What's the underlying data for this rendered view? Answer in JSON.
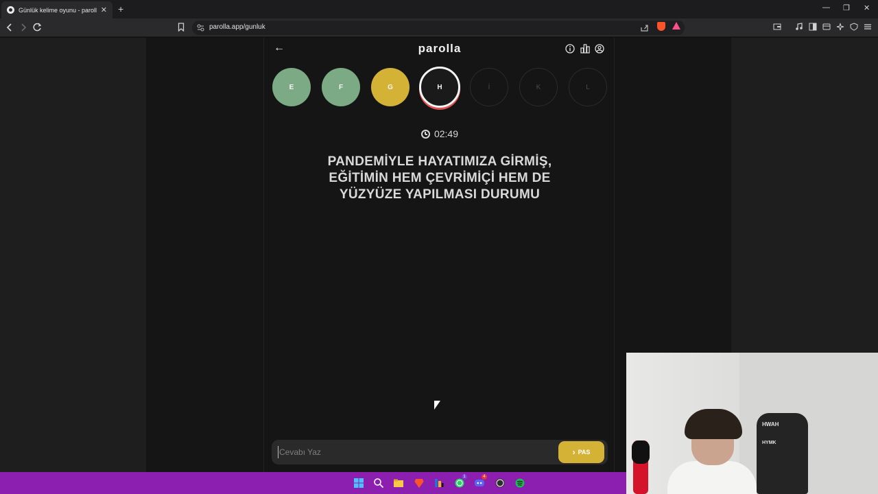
{
  "browser": {
    "tab_title": "Günlük kelime oyunu - parolla -",
    "tab_close": "✕",
    "new_tab": "+",
    "url": "parolla.app/gunluk",
    "win_min": "—",
    "win_max": "❐",
    "win_close": "✕"
  },
  "app": {
    "logo": "parolla",
    "back": "←",
    "letters": [
      {
        "letter": "E",
        "state": "correct"
      },
      {
        "letter": "F",
        "state": "correct"
      },
      {
        "letter": "G",
        "state": "passed"
      },
      {
        "letter": "H",
        "state": "active"
      },
      {
        "letter": "İ",
        "state": "pending"
      },
      {
        "letter": "K",
        "state": "pending"
      },
      {
        "letter": "L",
        "state": "pending"
      }
    ],
    "timer": "02:49",
    "question": "PANDEMİYLE HAYATIMIZA GİRMİŞ, EĞİTİMİN HEM ÇEVRİMİÇİ HEM DE YÜZYÜZE YAPILMASI DURUMU",
    "answer_placeholder": "Cevabı Yaz",
    "pass_label": "PAS",
    "pass_icon": "›"
  },
  "webcam": {
    "chair_brand": "HWAH",
    "chair_text": "HYMK"
  },
  "taskbar": {
    "badges": [
      "1",
      "4"
    ]
  },
  "colors": {
    "correct": "#7caa84",
    "passed": "#d4b236",
    "active_ring": "#f4f4f4",
    "taskbar": "#8c1fb0"
  }
}
